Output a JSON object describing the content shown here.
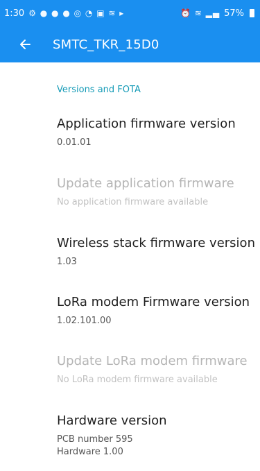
{
  "status_bar": {
    "time": "1:30",
    "notification_icons": "notification-icons",
    "battery": "57%"
  },
  "app_bar": {
    "back_icon": "arrow-left-icon",
    "title": "SMTC_TKR_15D0"
  },
  "section": {
    "header": "Versions and FOTA"
  },
  "items": [
    {
      "title": "Application firmware version",
      "summary": "0.01.01",
      "enabled": true
    },
    {
      "title": "Update application firmware",
      "summary": "No application firmware available",
      "enabled": false
    },
    {
      "title": "Wireless stack firmware version",
      "summary": "1.03",
      "enabled": true
    },
    {
      "title": "LoRa modem Firmware version",
      "summary": "1.02.101.00",
      "enabled": true
    },
    {
      "title": "Update LoRa modem firmware",
      "summary": "No LoRa modem firmware available",
      "enabled": false
    },
    {
      "title": "Hardware version",
      "summary_lines": [
        "PCB number 595",
        "Hardware 1.00"
      ],
      "enabled": true
    }
  ],
  "colors": {
    "primary": "#1a8ff0",
    "section_header": "#159bb7",
    "disabled_text": "#b5b5b5"
  }
}
